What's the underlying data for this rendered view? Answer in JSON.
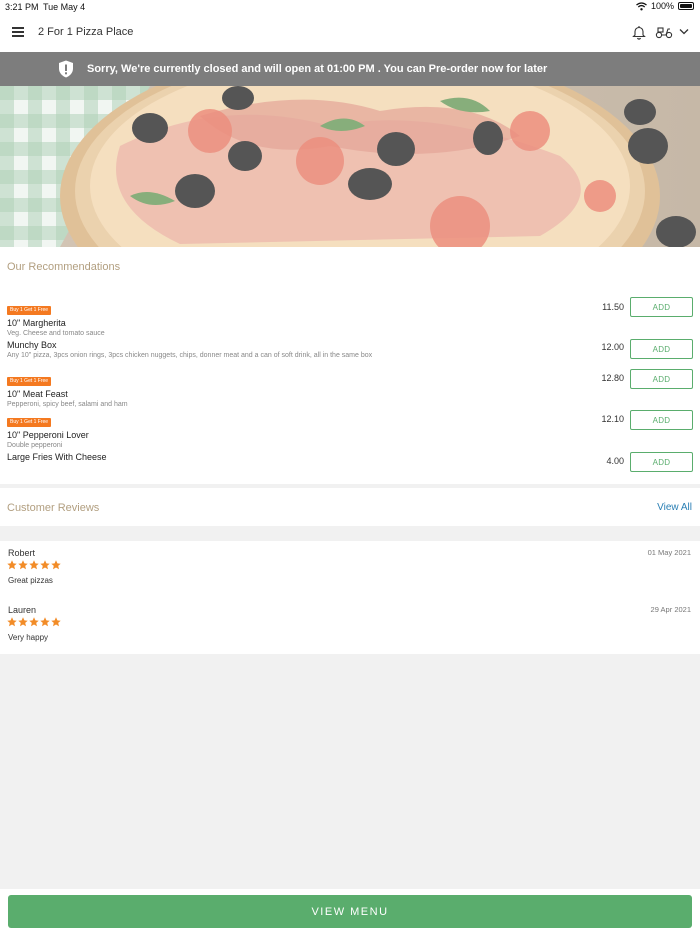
{
  "status_bar": {
    "time": "3:21 PM",
    "date": "Tue May 4",
    "battery": "100%"
  },
  "app_bar": {
    "title": "2 For 1 Pizza Place"
  },
  "banner": {
    "message": "Sorry, We're currently closed and will open at 01:00 PM . You can Pre-order now for later"
  },
  "recommendations": {
    "title": "Our Recommendations",
    "add_label": "ADD",
    "items": [
      {
        "badge": "Buy 1 Get 1 Free",
        "name": "10\" Margherita",
        "description": "Veg. Cheese and tomato sauce",
        "price": "11.50"
      },
      {
        "badge": "",
        "name": "Munchy Box",
        "description": "Any 10\" pizza, 3pcs onion rings, 3pcs chicken nuggets, chips, donner meat and a can of soft drink, all in the same box",
        "price": "12.00"
      },
      {
        "badge": "Buy 1 Get 1 Free",
        "name": "10\" Meat Feast",
        "description": "Pepperoni, spicy beef, salami and ham",
        "price": "12.80"
      },
      {
        "badge": "Buy 1 Get 1 Free",
        "name": "10\" Pepperoni Lover",
        "description": "Double pepperoni",
        "price": "12.10"
      },
      {
        "badge": "",
        "name": "Large Fries With Cheese",
        "description": "",
        "price": "4.00"
      }
    ]
  },
  "reviews": {
    "title": "Customer Reviews",
    "view_all": "View All",
    "items": [
      {
        "author": "Robert",
        "date": "01 May 2021",
        "rating": 5,
        "text": "Great pizzas"
      },
      {
        "author": "Lauren",
        "date": "29 Apr 2021",
        "rating": 5,
        "text": "Very happy"
      }
    ]
  },
  "footer": {
    "button_label": "VIEW MENU"
  },
  "colors": {
    "accent_green": "#5aad6d",
    "badge_orange": "#f47920",
    "banner_gray": "#7d7d7d",
    "section_title": "#b29f80",
    "link_blue": "#2a7fb4",
    "star": "#f28c28"
  }
}
